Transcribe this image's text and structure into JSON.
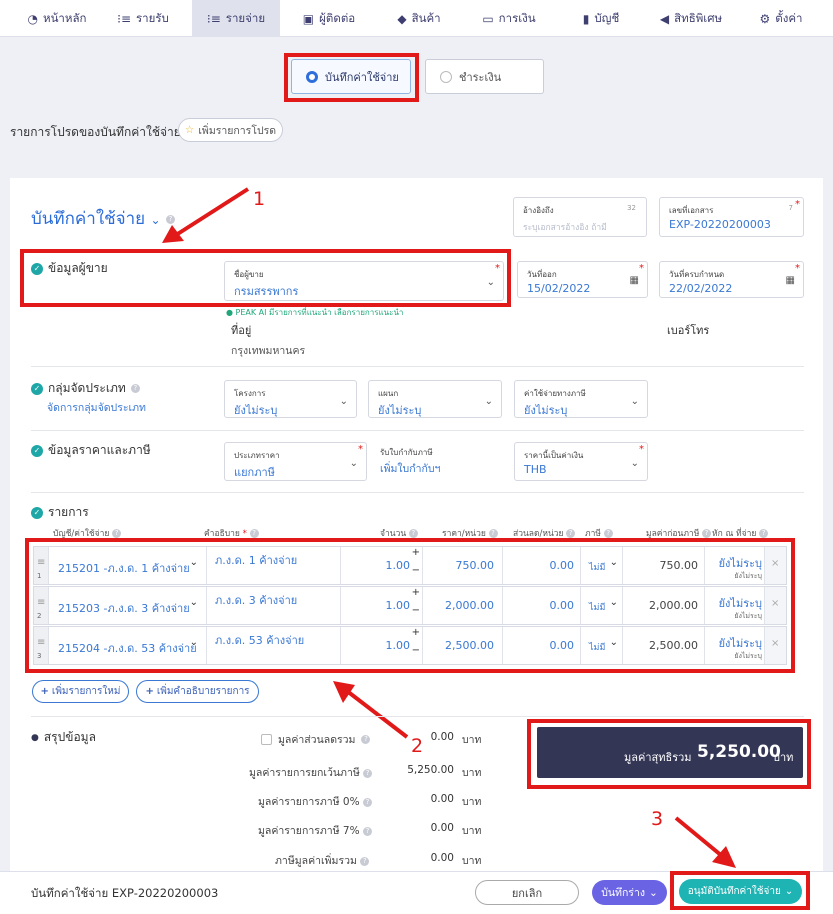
{
  "nav": {
    "items": [
      {
        "label": "หน้าหลัก",
        "icon": "dashboard-icon"
      },
      {
        "label": "รายรับ",
        "icon": "list-icon"
      },
      {
        "label": "รายจ่าย",
        "icon": "list-icon",
        "active": true
      },
      {
        "label": "ผู้ติดต่อ",
        "icon": "contacts-icon"
      },
      {
        "label": "สินค้า",
        "icon": "box-icon"
      },
      {
        "label": "การเงิน",
        "icon": "money-icon"
      },
      {
        "label": "บัญชี",
        "icon": "book-icon"
      },
      {
        "label": "สิทธิพิเศษ",
        "icon": "megaphone-icon"
      },
      {
        "label": "ตั้งค่า",
        "icon": "gear-icon"
      }
    ]
  },
  "mode": {
    "record_label": "บันทึกค่าใช้จ่าย",
    "pay_label": "ชำระเงิน"
  },
  "favorites": {
    "label": "รายการโปรดของบันทึกค่าใช้จ่าย",
    "add_button": "เพิ่มรายการโปรด"
  },
  "form": {
    "title": "บันทึกค่าใช้จ่าย",
    "reference": {
      "label": "อ้างอิงถึง",
      "placeholder": "ระบุเอกสารอ้างอิง ถ้ามี",
      "counter": "32"
    },
    "doc_number": {
      "label": "เลขที่เอกสาร",
      "value": "EXP-20220200003",
      "counter": "7"
    },
    "vendor_section": "ข้อมูลผู้ขาย",
    "vendor": {
      "label": "ชื่อผู้ขาย",
      "value": "กรมสรรพากร"
    },
    "issue_date": {
      "label": "วันที่ออก",
      "value": "15/02/2022"
    },
    "due_date": {
      "label": "วันที่ครบกำหนด",
      "value": "22/02/2022"
    },
    "ai_hint": "PEAK AI มีรายการที่แนะนำ เลือกรายการแนะนำ",
    "address_label": "ที่อยู่",
    "address_value": "กรุงเทพมหานคร",
    "phone_label": "เบอร์โทร",
    "category_section": "กลุ่มจัดประเภท",
    "category_link": "จัดการกลุ่มจัดประเภท",
    "project": {
      "label": "โครงการ",
      "value": "ยังไม่ระบุ"
    },
    "department": {
      "label": "แผนก",
      "value": "ยังไม่ระบุ"
    },
    "tax_expense": {
      "label": "ค่าใช้จ่ายทางภาษี",
      "value": "ยังไม่ระบุ"
    },
    "price_section": "ข้อมูลราคาและภาษี",
    "price_type": {
      "label": "ประเภทราคา",
      "value": "แยกภาษี"
    },
    "tax_invoice": {
      "label": "รับใบกำกับภาษี",
      "value": "เพิ่มใบกำกับฯ"
    },
    "currency": {
      "label": "ราคานี้เป็นค่าเงิน",
      "value": "THB"
    }
  },
  "items": {
    "section": "รายการ",
    "headers": {
      "account": "บัญชี/ค่าใช้จ่าย",
      "desc": "คำอธิบาย",
      "qty": "จำนวน",
      "price": "ราคา/หน่วย",
      "discount": "ส่วนลด/หน่วย",
      "vat": "ภาษี",
      "pretax": "มูลค่าก่อนภาษี",
      "wht": "หัก ณ ที่จ่าย"
    },
    "rows": [
      {
        "no": "1",
        "account": "215201 -ภ.ง.ด. 1 ค้างจ่าย",
        "desc": "ภ.ง.ด. 1 ค้างจ่าย",
        "qty": "1.00",
        "price": "750.00",
        "discount": "0.00",
        "vat": "ไม่มี",
        "pretax": "750.00",
        "wht": "ยังไม่ระบุ",
        "wht_sub": "ยังไม่ระบุ"
      },
      {
        "no": "2",
        "account": "215203 -ภ.ง.ด. 3 ค้างจ่าย",
        "desc": "ภ.ง.ด. 3 ค้างจ่าย",
        "qty": "1.00",
        "price": "2,000.00",
        "discount": "0.00",
        "vat": "ไม่มี",
        "pretax": "2,000.00",
        "wht": "ยังไม่ระบุ",
        "wht_sub": "ยังไม่ระบุ"
      },
      {
        "no": "3",
        "account": "215204 -ภ.ง.ด. 53 ค้างจ่าย",
        "desc": "ภ.ง.ด. 53 ค้างจ่าย",
        "qty": "1.00",
        "price": "2,500.00",
        "discount": "0.00",
        "vat": "ไม่มี",
        "pretax": "2,500.00",
        "wht": "ยังไม่ระบุ",
        "wht_sub": "ยังไม่ระบุ"
      }
    ],
    "add_item": "เพิ่มรายการใหม่",
    "add_desc": "เพิ่มคำอธิบายรายการ"
  },
  "summary": {
    "section": "สรุปข้อมูล",
    "rows": [
      {
        "label": "มูลค่าส่วนลดรวม",
        "value": "0.00",
        "unit": "บาท"
      },
      {
        "label": "มูลค่ารายการยกเว้นภาษี",
        "value": "5,250.00",
        "unit": "บาท"
      },
      {
        "label": "มูลค่ารายการภาษี 0%",
        "value": "0.00",
        "unit": "บาท"
      },
      {
        "label": "มูลค่ารายการภาษี 7%",
        "value": "0.00",
        "unit": "บาท"
      },
      {
        "label": "ภาษีมูลค่าเพิ่มรวม",
        "value": "0.00",
        "unit": "บาท"
      }
    ],
    "net_label": "มูลค่าสุทธิรวม",
    "net_value": "5,250.00",
    "net_unit": "บาท"
  },
  "footer": {
    "doc_title": "บันทึกค่าใช้จ่าย EXP-20220200003",
    "cancel": "ยกเลิก",
    "draft": "บันทึกร่าง",
    "approve": "อนุมัติบันทึกค่าใช้จ่าย"
  },
  "annotations": [
    "1",
    "2",
    "3"
  ],
  "colors": {
    "accent": "#2b6cd8",
    "highlight": "#e11919",
    "teal": "#1fa7a7",
    "dark": "#343656",
    "purple": "#6a63e4"
  }
}
